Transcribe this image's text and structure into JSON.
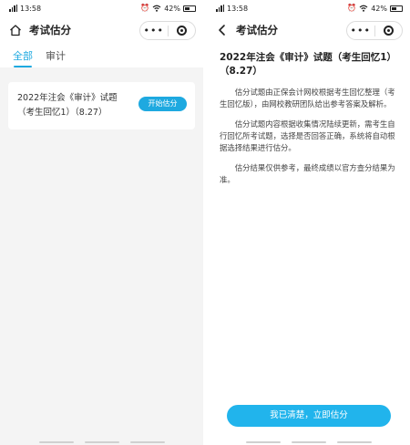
{
  "status_bar": {
    "time": "13:58",
    "battery_percent": "42%",
    "icons": [
      "signal-icon",
      "wifi-icon",
      "alarm-icon",
      "battery-icon"
    ]
  },
  "left_screen": {
    "nav": {
      "title": "考试估分",
      "home_icon": "home-icon",
      "more_icon": "more-icon",
      "close_icon": "close-icon"
    },
    "tabs": [
      {
        "label": "全部",
        "active": true
      },
      {
        "label": "审计",
        "active": false
      }
    ],
    "card": {
      "title": "2022年注会《审计》试题（考生回忆1）（8.27）",
      "button_label": "开始估分"
    }
  },
  "right_screen": {
    "nav": {
      "title": "考试估分",
      "back_icon": "back-icon",
      "more_icon": "more-icon",
      "close_icon": "close-icon"
    },
    "heading": "2022年注会《审计》试题（考生回忆1）（8.27）",
    "paragraphs": [
      "估分试题由正保会计网校根据考生回忆整理（考生回忆版），由网校教研团队给出参考答案及解析。",
      "估分试题内容根据收集情况陆续更新，需考生自行回忆所考试题，选择是否回答正确，系统将自动根据选择结果进行估分。",
      "估分结果仅供参考，最终成绩以官方查分结果为准。"
    ],
    "confirm_button": "我已清楚，立即估分"
  },
  "colors": {
    "accent": "#1ea9e0",
    "button": "#21b4ec",
    "background_list": "#f4f4f4"
  }
}
